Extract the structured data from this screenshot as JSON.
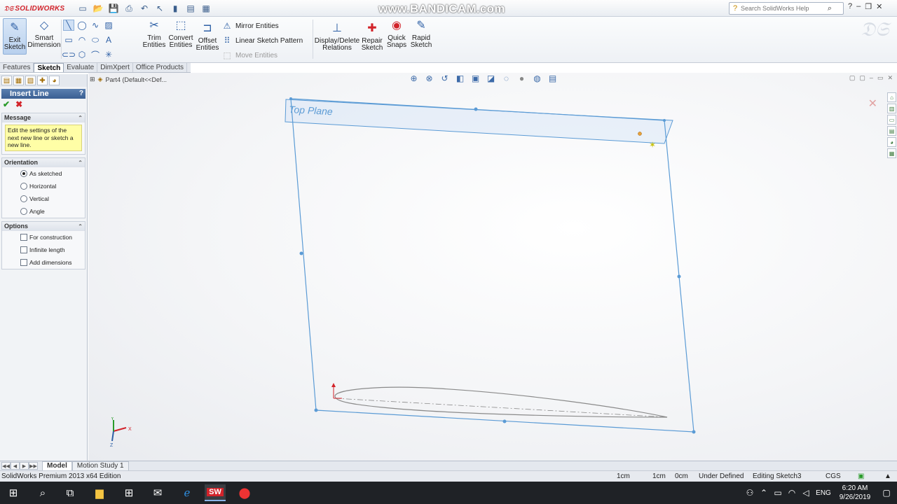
{
  "app": {
    "logo_text": "SOLIDWORKS",
    "watermark": "www.BANDICAM.com",
    "search_placeholder": "Search SolidWorks Help"
  },
  "ribbon": {
    "exit_sketch": "Exit\nSketch",
    "smart_dimension": "Smart\nDimension",
    "trim_entities": "Trim\nEntities",
    "convert_entities": "Convert\nEntities",
    "offset_entities": "Offset\nEntities",
    "mirror_entities": "Mirror Entities",
    "linear_sketch_pattern": "Linear Sketch Pattern",
    "move_entities": "Move Entities",
    "display_delete_relations": "Display/Delete\nRelations",
    "repair_sketch": "Repair\nSketch",
    "quick_snaps": "Quick\nSnaps",
    "rapid_sketch": "Rapid\nSketch"
  },
  "command_tabs": [
    "Features",
    "Sketch",
    "Evaluate",
    "DimXpert",
    "Office Products"
  ],
  "property_manager": {
    "title": "Insert Line",
    "message_header": "Message",
    "message": "Edit the settings of the next new line or sketch a new line.",
    "orientation_header": "Orientation",
    "orientation_options": [
      "As sketched",
      "Horizontal",
      "Vertical",
      "Angle"
    ],
    "orientation_selected": "As sketched",
    "options_header": "Options",
    "options": [
      "For construction",
      "Infinite length",
      "Add dimensions"
    ]
  },
  "graphics": {
    "breadcrumb": "Part4  (Default<<Def...",
    "plane_label": "Top Plane",
    "triad_x": "X",
    "triad_y": "Y",
    "triad_z": "Z"
  },
  "bottom_tabs": [
    "Model",
    "Motion Study 1"
  ],
  "status": {
    "edition": "SolidWorks Premium 2013 x64 Edition",
    "val1": "1cm",
    "val2": "1cm",
    "val3": "0cm",
    "state": "Under Defined",
    "editing": "Editing Sketch3",
    "units": "CGS"
  },
  "taskbar": {
    "lang": "ENG",
    "time": "6:20 AM",
    "date": "9/26/2019"
  },
  "colors": {
    "plane_blue": "#5b9bd5",
    "logo_red": "#d2232a",
    "sketch_gray": "#777777"
  }
}
